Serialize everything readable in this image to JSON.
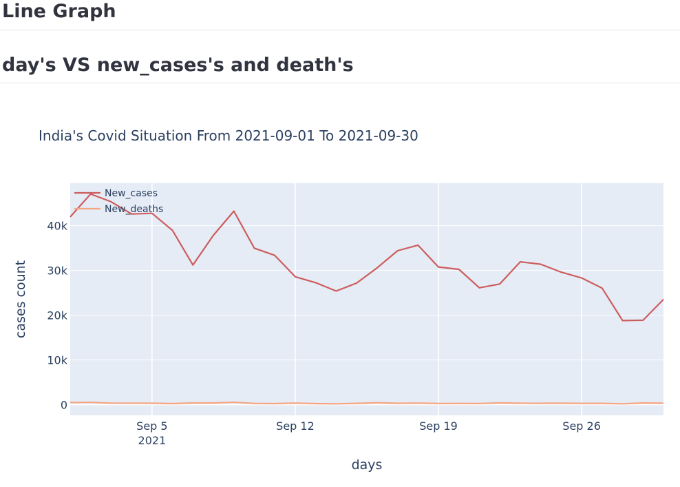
{
  "page": {
    "heading": "Line Graph",
    "subheading": "day's VS new_cases's and death's"
  },
  "colors": {
    "plot_bg": "#e5ecf6",
    "grid": "#ffffff",
    "new_cases": "#cd5c5c",
    "new_deaths": "#f4a582",
    "text": "#2a3f5f"
  },
  "chart_data": {
    "type": "line",
    "title": "India's Covid Situation From 2021-09-01 To 2021-09-30",
    "xlabel": "days",
    "ylabel": "cases count",
    "x": [
      "2021-09-01",
      "2021-09-02",
      "2021-09-03",
      "2021-09-04",
      "2021-09-05",
      "2021-09-06",
      "2021-09-07",
      "2021-09-08",
      "2021-09-09",
      "2021-09-10",
      "2021-09-11",
      "2021-09-12",
      "2021-09-13",
      "2021-09-14",
      "2021-09-15",
      "2021-09-16",
      "2021-09-17",
      "2021-09-18",
      "2021-09-19",
      "2021-09-20",
      "2021-09-21",
      "2021-09-22",
      "2021-09-23",
      "2021-09-24",
      "2021-09-25",
      "2021-09-26",
      "2021-09-27",
      "2021-09-28",
      "2021-09-29",
      "2021-09-30"
    ],
    "series": [
      {
        "name": "New_cases",
        "values": [
          41965,
          47092,
          45352,
          42618,
          42766,
          38948,
          31222,
          37875,
          43263,
          34973,
          33376,
          28591,
          27254,
          25404,
          27176,
          30570,
          34403,
          35662,
          30773,
          30256,
          26115,
          26964,
          31923,
          31382,
          29616,
          28326,
          26041,
          18795,
          18870,
          23529
        ]
      },
      {
        "name": "New_deaths",
        "values": [
          460,
          509,
          340,
          330,
          308,
          219,
          369,
          369,
          530,
          260,
          219,
          338,
          219,
          166,
          284,
          431,
          290,
          339,
          256,
          270,
          252,
          383,
          318,
          290,
          318,
          276,
          276,
          179,
          378,
          311
        ]
      }
    ],
    "x_ticks": [
      {
        "date": "2021-09-05",
        "label": "Sep 5",
        "sublabel": "2021"
      },
      {
        "date": "2021-09-12",
        "label": "Sep 12",
        "sublabel": ""
      },
      {
        "date": "2021-09-19",
        "label": "Sep 19",
        "sublabel": ""
      },
      {
        "date": "2021-09-26",
        "label": "Sep 26",
        "sublabel": ""
      }
    ],
    "y_ticks": [
      {
        "value": 0,
        "label": "0"
      },
      {
        "value": 10000,
        "label": "10k"
      },
      {
        "value": 20000,
        "label": "20k"
      },
      {
        "value": 30000,
        "label": "30k"
      },
      {
        "value": 40000,
        "label": "40k"
      }
    ],
    "xlim": [
      "2021-09-01",
      "2021-09-30"
    ],
    "ylim": [
      -2400,
      49500
    ],
    "grid": true,
    "legend_position": "top-left"
  }
}
